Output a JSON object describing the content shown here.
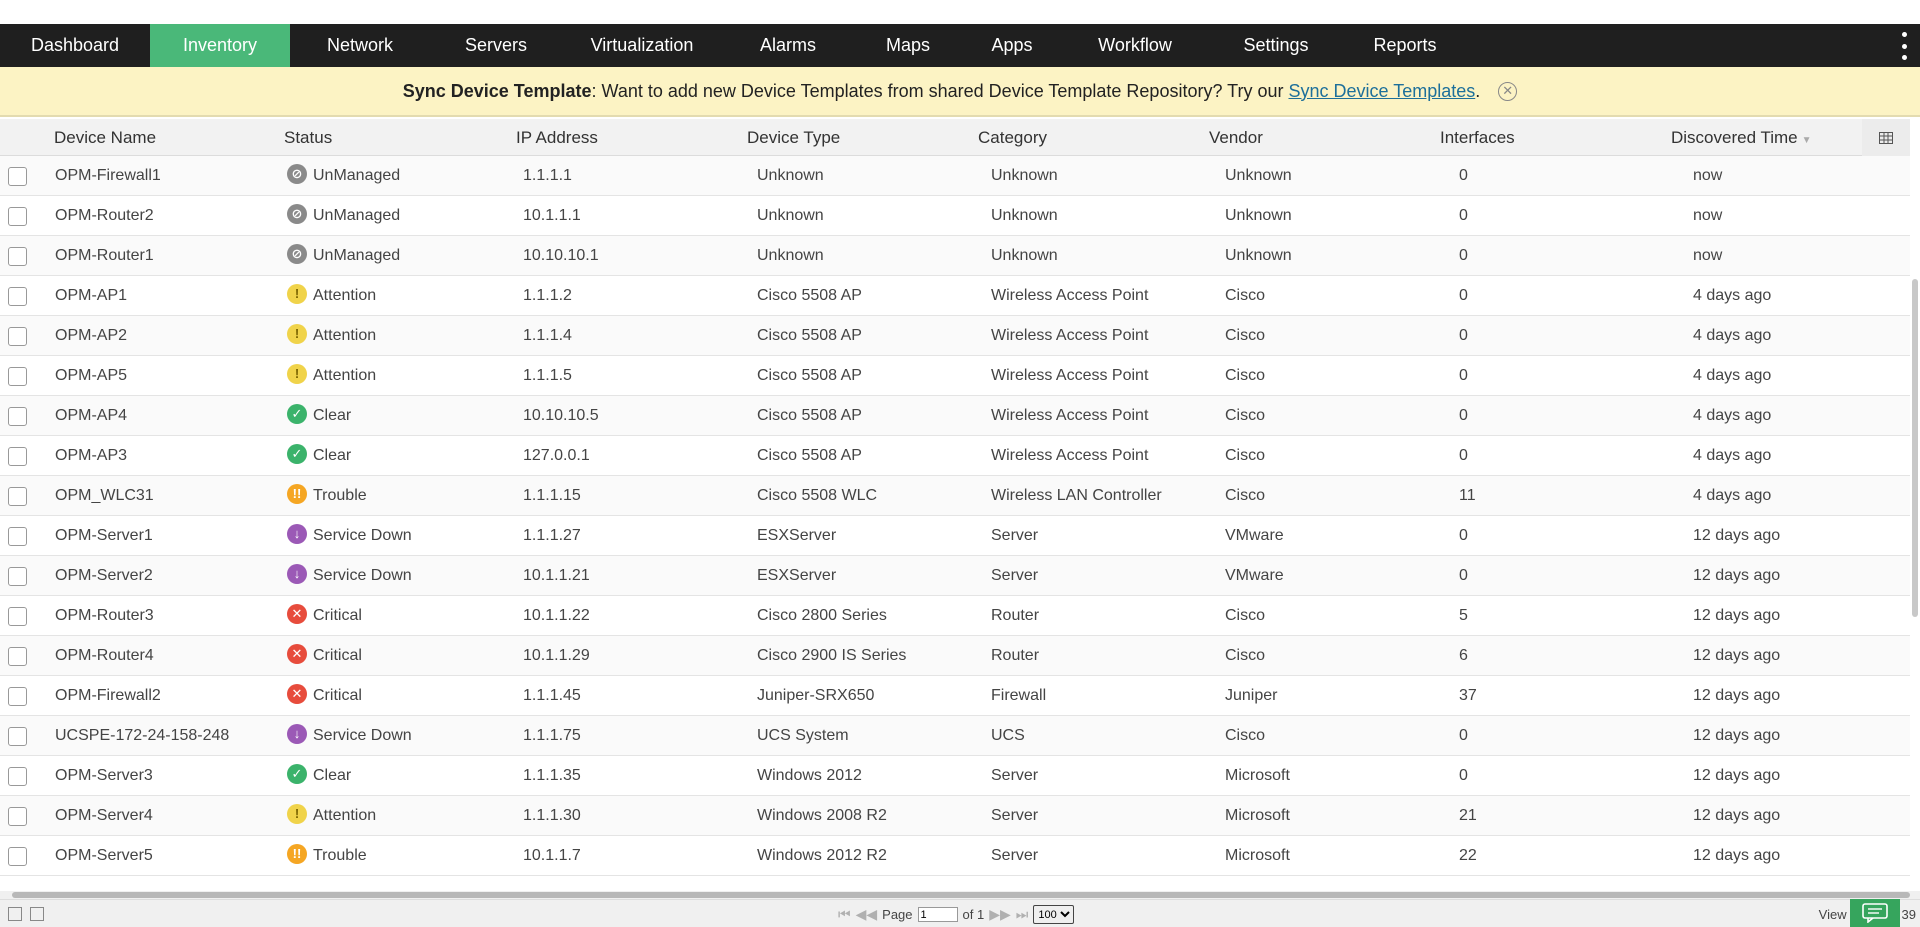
{
  "nav": {
    "items": [
      "Dashboard",
      "Inventory",
      "Network",
      "Servers",
      "Virtualization",
      "Alarms",
      "Maps",
      "Apps",
      "Workflow",
      "Settings",
      "Reports"
    ],
    "active": "Inventory",
    "active_color": "#4ab879"
  },
  "banner": {
    "title": "Sync Device Template",
    "message": ": Want to add new Device Templates from shared Device Template Repository? Try our ",
    "link": "Sync Device Templates",
    "suffix": ".",
    "close_icon": "✕"
  },
  "table": {
    "columns": [
      "Device Name",
      "Status",
      "IP Address",
      "Device Type",
      "Category",
      "Vendor",
      "Interfaces",
      "Discovered Time"
    ],
    "sorted_column": "Discovered Time",
    "rows": [
      {
        "name": "OPM-Firewall1",
        "status": "UnManaged",
        "ip": "1.1.1.1",
        "type": "Unknown",
        "category": "Unknown",
        "vendor": "Unknown",
        "interfaces": "0",
        "time": "now"
      },
      {
        "name": "OPM-Router2",
        "status": "UnManaged",
        "ip": "10.1.1.1",
        "type": "Unknown",
        "category": "Unknown",
        "vendor": "Unknown",
        "interfaces": "0",
        "time": "now"
      },
      {
        "name": "OPM-Router1",
        "status": "UnManaged",
        "ip": "10.10.10.1",
        "type": "Unknown",
        "category": "Unknown",
        "vendor": "Unknown",
        "interfaces": "0",
        "time": "now"
      },
      {
        "name": "OPM-AP1",
        "status": "Attention",
        "ip": "1.1.1.2",
        "type": "Cisco 5508 AP",
        "category": "Wireless Access Point",
        "vendor": "Cisco",
        "interfaces": "0",
        "time": "4 days ago"
      },
      {
        "name": "OPM-AP2",
        "status": "Attention",
        "ip": "1.1.1.4",
        "type": "Cisco 5508 AP",
        "category": "Wireless Access Point",
        "vendor": "Cisco",
        "interfaces": "0",
        "time": "4 days ago"
      },
      {
        "name": "OPM-AP5",
        "status": "Attention",
        "ip": "1.1.1.5",
        "type": "Cisco 5508 AP",
        "category": "Wireless Access Point",
        "vendor": "Cisco",
        "interfaces": "0",
        "time": "4 days ago"
      },
      {
        "name": "OPM-AP4",
        "status": "Clear",
        "ip": "10.10.10.5",
        "type": "Cisco 5508 AP",
        "category": "Wireless Access Point",
        "vendor": "Cisco",
        "interfaces": "0",
        "time": "4 days ago"
      },
      {
        "name": "OPM-AP3",
        "status": "Clear",
        "ip": "127.0.0.1",
        "type": "Cisco 5508 AP",
        "category": "Wireless Access Point",
        "vendor": "Cisco",
        "interfaces": "0",
        "time": "4 days ago"
      },
      {
        "name": "OPM_WLC31",
        "status": "Trouble",
        "ip": "1.1.1.15",
        "type": "Cisco 5508 WLC",
        "category": "Wireless LAN Controller",
        "vendor": "Cisco",
        "interfaces": "11",
        "time": "4 days ago"
      },
      {
        "name": "OPM-Server1",
        "status": "Service Down",
        "ip": "1.1.1.27",
        "type": "ESXServer",
        "category": "Server",
        "vendor": "VMware",
        "interfaces": "0",
        "time": "12 days ago"
      },
      {
        "name": "OPM-Server2",
        "status": "Service Down",
        "ip": "10.1.1.21",
        "type": "ESXServer",
        "category": "Server",
        "vendor": "VMware",
        "interfaces": "0",
        "time": "12 days ago"
      },
      {
        "name": "OPM-Router3",
        "status": "Critical",
        "ip": "10.1.1.22",
        "type": "Cisco 2800 Series",
        "category": "Router",
        "vendor": "Cisco",
        "interfaces": "5",
        "time": "12 days ago"
      },
      {
        "name": "OPM-Router4",
        "status": "Critical",
        "ip": "10.1.1.29",
        "type": "Cisco 2900 IS Series",
        "category": "Router",
        "vendor": "Cisco",
        "interfaces": "6",
        "time": "12 days ago"
      },
      {
        "name": "OPM-Firewall2",
        "status": "Critical",
        "ip": "1.1.1.45",
        "type": "Juniper-SRX650",
        "category": "Firewall",
        "vendor": "Juniper",
        "interfaces": "37",
        "time": "12 days ago"
      },
      {
        "name": "UCSPE-172-24-158-248",
        "status": "Service Down",
        "ip": "1.1.1.75",
        "type": "UCS System",
        "category": "UCS",
        "vendor": "Cisco",
        "interfaces": "0",
        "time": "12 days ago"
      },
      {
        "name": "OPM-Server3",
        "status": "Clear",
        "ip": "1.1.1.35",
        "type": "Windows 2012",
        "category": "Server",
        "vendor": "Microsoft",
        "interfaces": "0",
        "time": "12 days ago"
      },
      {
        "name": "OPM-Server4",
        "status": "Attention",
        "ip": "1.1.1.30",
        "type": "Windows 2008 R2",
        "category": "Server",
        "vendor": "Microsoft",
        "interfaces": "21",
        "time": "12 days ago"
      },
      {
        "name": "OPM-Server5",
        "status": "Trouble",
        "ip": "10.1.1.7",
        "type": "Windows 2012 R2",
        "category": "Server",
        "vendor": "Microsoft",
        "interfaces": "22",
        "time": "12 days ago"
      }
    ]
  },
  "status_styles": {
    "UnManaged": {
      "color": "#8a8a8a",
      "glyph": "⊘",
      "icon": "unmanaged-icon"
    },
    "Attention": {
      "color": "#f0d34a",
      "glyph": "!",
      "icon": "attention-icon"
    },
    "Clear": {
      "color": "#3bb36b",
      "glyph": "✓",
      "icon": "clear-icon"
    },
    "Trouble": {
      "color": "#f5a623",
      "glyph": "!!",
      "icon": "trouble-icon"
    },
    "Service Down": {
      "color": "#9b59b6",
      "glyph": "↓",
      "icon": "service-down-icon"
    },
    "Critical": {
      "color": "#e74c3c",
      "glyph": "✕",
      "icon": "critical-icon"
    }
  },
  "footer": {
    "page_label": "Page",
    "page_value": "1",
    "of_label": "of 1",
    "page_size": "100",
    "view_text": "View 1 - 39 of 39"
  }
}
